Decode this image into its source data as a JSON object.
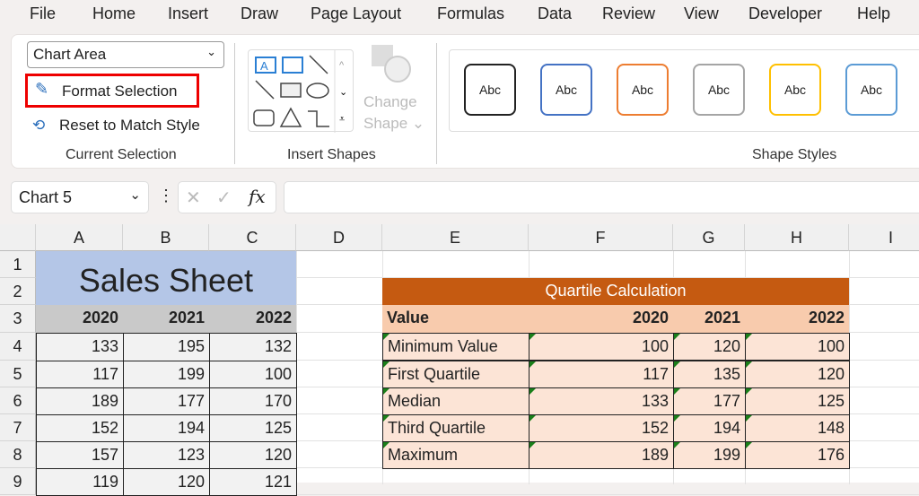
{
  "menu": [
    "File",
    "Home",
    "Insert",
    "Draw",
    "Page Layout",
    "Formulas",
    "Data",
    "Review",
    "View",
    "Developer",
    "Help"
  ],
  "ribbon": {
    "selection_dropdown": "Chart Area",
    "format_selection": "Format Selection",
    "reset_style": "Reset to Match Style",
    "group_current": "Current Selection",
    "group_shapes": "Insert Shapes",
    "change_shape_1": "Change",
    "change_shape_2": "Shape",
    "group_styles": "Shape Styles",
    "style_label": "Abc",
    "style_colors": [
      "#222222",
      "#4472c4",
      "#ed7d31",
      "#a5a5a5",
      "#ffc000",
      "#5b9bd5"
    ]
  },
  "formula_bar": {
    "name_box": "Chart 5",
    "fx": "fx",
    "value": ""
  },
  "columns": [
    "A",
    "B",
    "C",
    "D",
    "E",
    "F",
    "G",
    "H",
    "I"
  ],
  "rows": [
    "1",
    "2",
    "3",
    "4",
    "5",
    "6",
    "7",
    "8",
    "9"
  ],
  "sales": {
    "title": "Sales Sheet",
    "headers": [
      "2020",
      "2021",
      "2022"
    ],
    "data": [
      [
        "133",
        "195",
        "132"
      ],
      [
        "117",
        "199",
        "100"
      ],
      [
        "189",
        "177",
        "170"
      ],
      [
        "152",
        "194",
        "125"
      ],
      [
        "157",
        "123",
        "120"
      ],
      [
        "119",
        "120",
        "121"
      ]
    ]
  },
  "quartile": {
    "title": "Quartile Calculation",
    "headers": [
      "Value",
      "2020",
      "2021",
      "2022"
    ],
    "data": [
      [
        "Minimum Value",
        "100",
        "120",
        "100"
      ],
      [
        "First Quartile",
        "117",
        "135",
        "120"
      ],
      [
        "Median",
        "133",
        "177",
        "125"
      ],
      [
        "Third Quartile",
        "152",
        "194",
        "148"
      ],
      [
        "Maximum",
        "189",
        "199",
        "176"
      ]
    ]
  }
}
